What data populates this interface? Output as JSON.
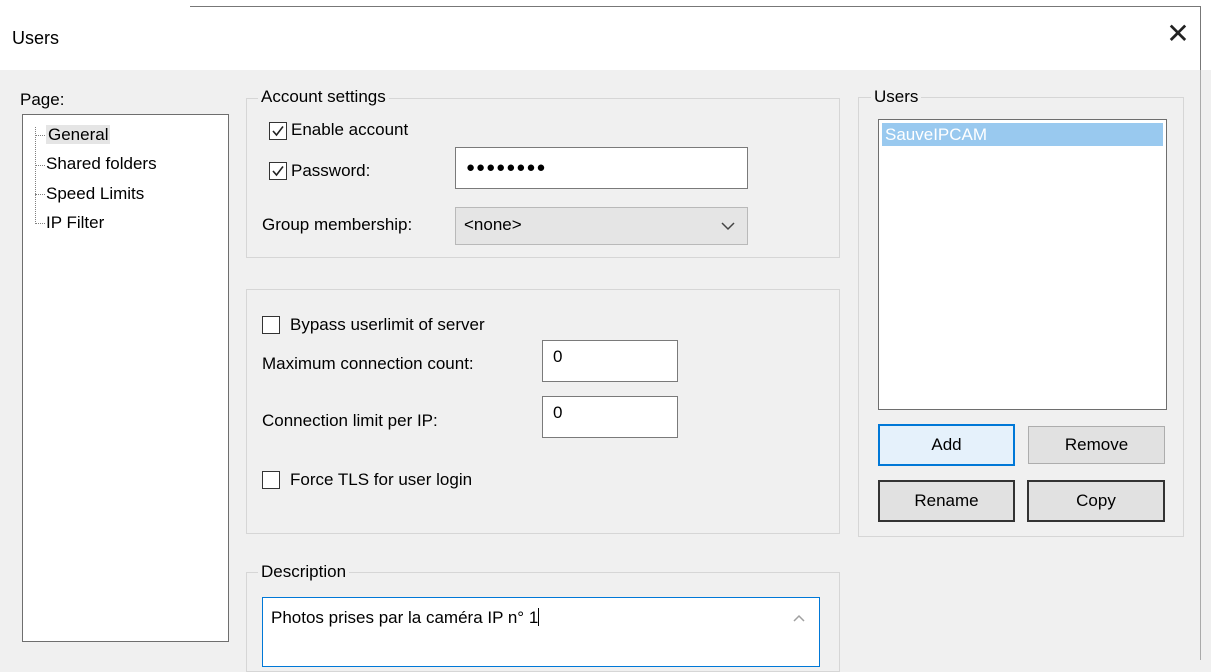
{
  "window": {
    "title": "Users",
    "close_glyph": "✕"
  },
  "page_tree": {
    "label": "Page:",
    "items": [
      {
        "label": "General",
        "selected": true
      },
      {
        "label": "Shared folders",
        "selected": false
      },
      {
        "label": "Speed Limits",
        "selected": false
      },
      {
        "label": "IP Filter",
        "selected": false
      }
    ]
  },
  "account_settings": {
    "title": "Account settings",
    "enable_account": {
      "label": "Enable account",
      "checked": true
    },
    "password": {
      "label": "Password:",
      "checked": true,
      "value": "●●●●●●●●"
    },
    "group_membership": {
      "label": "Group membership:",
      "selected": "<none>"
    }
  },
  "limits": {
    "bypass_userlimit": {
      "label": "Bypass userlimit of server",
      "checked": false
    },
    "max_connection_count": {
      "label": "Maximum connection count:",
      "value": "0"
    },
    "connection_limit_per_ip": {
      "label": "Connection limit per IP:",
      "value": "0"
    },
    "force_tls": {
      "label": "Force TLS for user login",
      "checked": false
    }
  },
  "description": {
    "title": "Description",
    "value": "Photos prises par la caméra IP n° 1"
  },
  "users_panel": {
    "title": "Users",
    "users": [
      "SauveIPCAM"
    ],
    "buttons": {
      "add": "Add",
      "remove": "Remove",
      "rename": "Rename",
      "copy": "Copy"
    }
  },
  "icons": {
    "close": "close-icon",
    "check": "checkmark-icon",
    "dropdown": "chevron-down-icon",
    "scroll_up": "scroll-up-arrow-icon"
  },
  "colors": {
    "focus_accent": "#0078d7",
    "selection": "#99c9ef",
    "window_bg": "#f0f0f0"
  }
}
